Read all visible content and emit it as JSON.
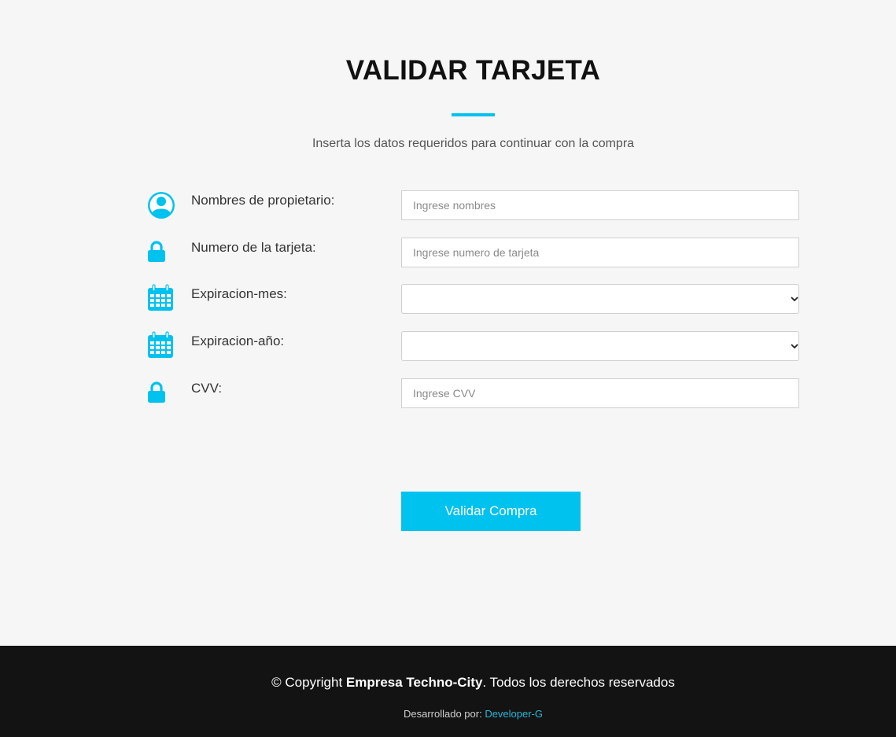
{
  "header": {
    "title": "VALIDAR TARJETA",
    "subtitle": "Inserta los datos requeridos para continuar con la compra"
  },
  "form": {
    "fields": [
      {
        "icon": "user-icon",
        "label": "Nombres de propietario:",
        "placeholder": "Ingrese nombres",
        "value": ""
      },
      {
        "icon": "lock-icon",
        "label": "Numero de la tarjeta:",
        "placeholder": "Ingrese numero de tarjeta",
        "value": ""
      },
      {
        "icon": "calendar-icon",
        "label": "Expiracion-mes:",
        "selected": ""
      },
      {
        "icon": "calendar-icon",
        "label": "Expiracion-año:",
        "selected": ""
      },
      {
        "icon": "lock-icon",
        "label": "CVV:",
        "placeholder": "Ingrese CVV",
        "value": ""
      }
    ],
    "submit_label": "Validar Compra"
  },
  "footer": {
    "copyright_prefix": "© Copyright ",
    "company": "Empresa Techno-City",
    "copyright_suffix": ". Todos los derechos reservados",
    "developed_by_label": "Desarrollado por: ",
    "developer_link": "Developer-G"
  },
  "colors": {
    "accent": "#00c2ee",
    "background": "#f6f6f6",
    "footer": "#131313"
  }
}
